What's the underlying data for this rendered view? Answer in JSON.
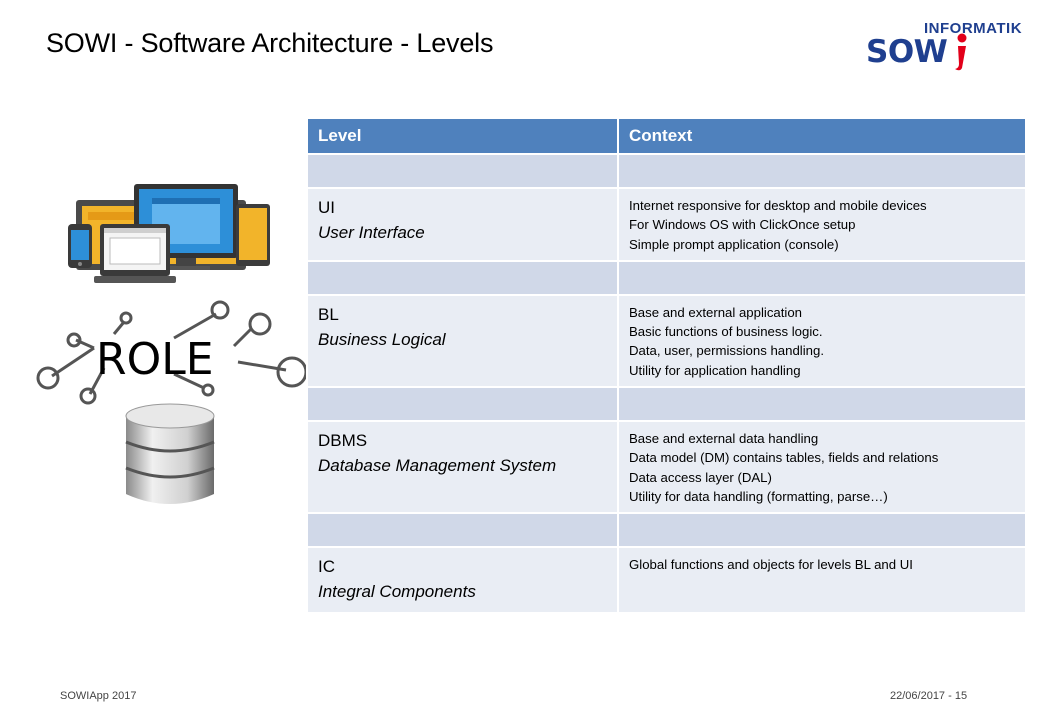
{
  "slide": {
    "title": "SOWI - Software Architecture - Levels"
  },
  "logo": {
    "top": "INFORMATIK",
    "main": "SOW"
  },
  "illustrations": {
    "role_text": "ROLE",
    "icons": [
      "devices-icon",
      "role-network-icon",
      "database-icon"
    ]
  },
  "table": {
    "headers": [
      "Level",
      "Context"
    ],
    "rows": [
      {
        "code": "UI",
        "name": "User Interface",
        "context": [
          "Internet responsive for desktop and mobile devices",
          "For Windows OS with ClickOnce setup",
          "Simple prompt  application (console)"
        ]
      },
      {
        "code": "BL",
        "name": "Business Logical",
        "context": [
          "Base and external application",
          "Basic functions of business logic.",
          "Data, user, permissions handling.",
          "Utility for application handling"
        ]
      },
      {
        "code": "DBMS",
        "name": "Database Management System",
        "context": [
          "Base and external data handling",
          "Data model (DM) contains tables, fields and relations",
          "Data access layer (DAL)",
          "Utility for data handling (formatting, parse…)"
        ]
      },
      {
        "code": "IC",
        "name": "Integral Components",
        "context": [
          "Global functions and objects for levels BL and UI"
        ]
      }
    ]
  },
  "footer": {
    "left": "SOWIApp 2017",
    "right": "22/06/2017 - 15"
  },
  "colors": {
    "header": "#4f81bd",
    "spacer_row": "#d0d8e8",
    "content_row": "#e9edf4",
    "logo": "#1f3f8f",
    "logo_accent": "#e2001a"
  }
}
